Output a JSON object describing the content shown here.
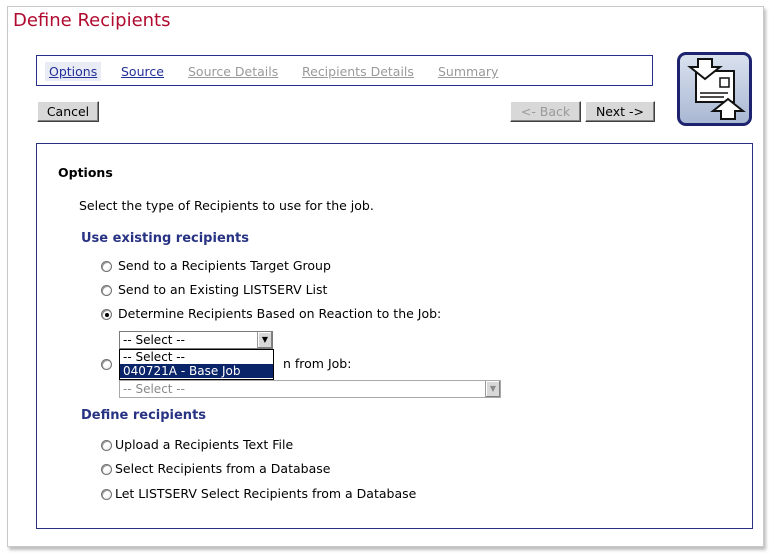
{
  "title": "Define Recipients",
  "tabs": [
    {
      "label": "Options",
      "state": "active"
    },
    {
      "label": "Source",
      "state": "link"
    },
    {
      "label": "Source Details",
      "state": "disabled"
    },
    {
      "label": "Recipients Details",
      "state": "disabled"
    },
    {
      "label": "Summary",
      "state": "disabled"
    }
  ],
  "buttons": {
    "cancel": "Cancel",
    "back": "<- Back",
    "next": "Next ->"
  },
  "logo_icon": "transfer-card-icon",
  "panel": {
    "heading": "Options",
    "instruction": "Select the type of Recipients to use for the job.",
    "existing": {
      "title": "Use existing recipients",
      "options": [
        {
          "label": "Send to a Recipients Target Group",
          "checked": false
        },
        {
          "label": "Send to an Existing LISTSERV List",
          "checked": false
        },
        {
          "label": "Determine Recipients Based on Reaction to the Job:",
          "checked": true
        },
        {
          "label": "n from Job:",
          "checked": false
        }
      ],
      "reaction_select": {
        "value": "-- Select --",
        "options": [
          "-- Select --",
          "040721A - Base Job"
        ],
        "highlighted": "040721A - Base Job"
      },
      "job_select": {
        "value": "-- Select --",
        "disabled": true
      }
    },
    "define": {
      "title": "Define recipients",
      "options": [
        {
          "label": "Upload a Recipients Text File",
          "checked": false
        },
        {
          "label": "Select Recipients from a Database",
          "checked": false
        },
        {
          "label": "Let LISTSERV Select Recipients from a Database",
          "checked": false
        }
      ]
    }
  },
  "colors": {
    "title": "#b00a2f",
    "accent": "#283384",
    "selection": "#0a246a"
  }
}
